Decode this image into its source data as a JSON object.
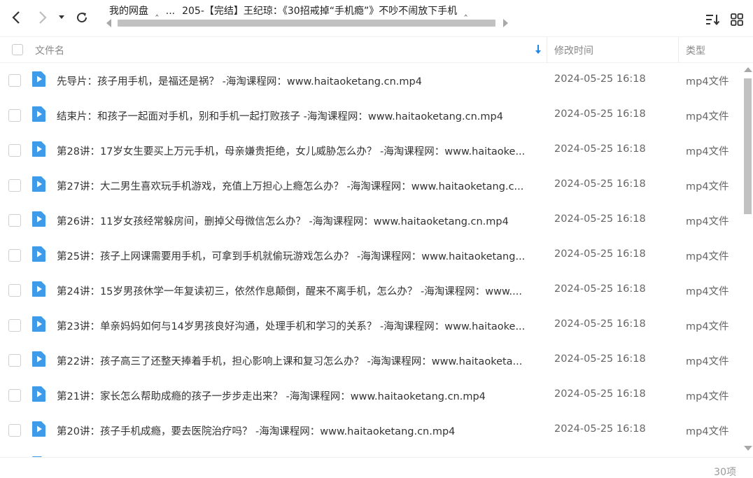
{
  "toolbar": {
    "breadcrumb": [
      "我的网盘",
      "...",
      "205-【完结】王纪琼：《30招戒掉“手机瘾”》不吵不闹放下手机"
    ],
    "breadcrumb_separators": [
      "",
      ""
    ],
    "back_icon": "chevron-left-icon",
    "forward_icon": "chevron-right-icon",
    "history_icon": "caret-down-icon",
    "refresh_icon": "refresh-icon",
    "sort_icon": "sort-icon",
    "view_icon": "grid-view-icon"
  },
  "header": {
    "name": "文件名",
    "time": "修改时间",
    "type": "类型"
  },
  "files": [
    {
      "name": "先导片：孩子用手机，是福还是祸？ -海淘课程网：www.haitaoketang.cn.mp4",
      "time": "2024-05-25 16:18",
      "type": "mp4文件"
    },
    {
      "name": "结束片：和孩子一起面对手机，别和手机一起打败孩子 -海淘课程网：www.haitaoketang.cn.mp4",
      "time": "2024-05-25 16:18",
      "type": "mp4文件"
    },
    {
      "name": "第28讲：17岁女生要买上万元手机，母亲嫌贵拒绝，女儿威胁怎么办？ -海淘课程网：www.haitaoke...",
      "time": "2024-05-25 16:18",
      "type": "mp4文件"
    },
    {
      "name": "第27讲：大二男生喜欢玩手机游戏，充值上万担心上瘾怎么办？ -海淘课程网：www.haitaoketang.c...",
      "time": "2024-05-25 16:18",
      "type": "mp4文件"
    },
    {
      "name": "第26讲：11岁女孩经常躲房间，删掉父母微信怎么办？ -海淘课程网：www.haitaoketang.cn.mp4",
      "time": "2024-05-25 16:18",
      "type": "mp4文件"
    },
    {
      "name": "第25讲：孩子上网课需要用手机，可拿到手机就偷玩游戏怎么办？ -海淘课程网：www.haitaoketang...",
      "time": "2024-05-25 16:18",
      "type": "mp4文件"
    },
    {
      "name": "第24讲：15岁男孩休学一年复读初三，依然作息颠倒，醒来不离手机，怎么办？ -海淘课程网：www....",
      "time": "2024-05-25 16:18",
      "type": "mp4文件"
    },
    {
      "name": "第23讲：单亲妈妈如何与14岁男孩良好沟通，处理手机和学习的关系？ -海淘课程网：www.haitaoke...",
      "time": "2024-05-25 16:18",
      "type": "mp4文件"
    },
    {
      "name": "第22讲：孩子高三了还整天捧着手机，担心影响上课和复习怎么办？ -海淘课程网：www.haitaoketa...",
      "time": "2024-05-25 16:18",
      "type": "mp4文件"
    },
    {
      "name": "第21讲：家长怎么帮助成瘾的孩子一步步走出来？ -海淘课程网：www.haitaoketang.cn.mp4",
      "time": "2024-05-25 16:18",
      "type": "mp4文件"
    },
    {
      "name": "第20讲：孩子手机成瘾，要去医院治疗吗？ -海淘课程网：www.haitaoketang.cn.mp4",
      "time": "2024-05-25 16:18",
      "type": "mp4文件"
    }
  ],
  "footer": {
    "count": "30项"
  },
  "colors": {
    "file_icon": "#3d9be9",
    "accent": "#1e88e5"
  }
}
